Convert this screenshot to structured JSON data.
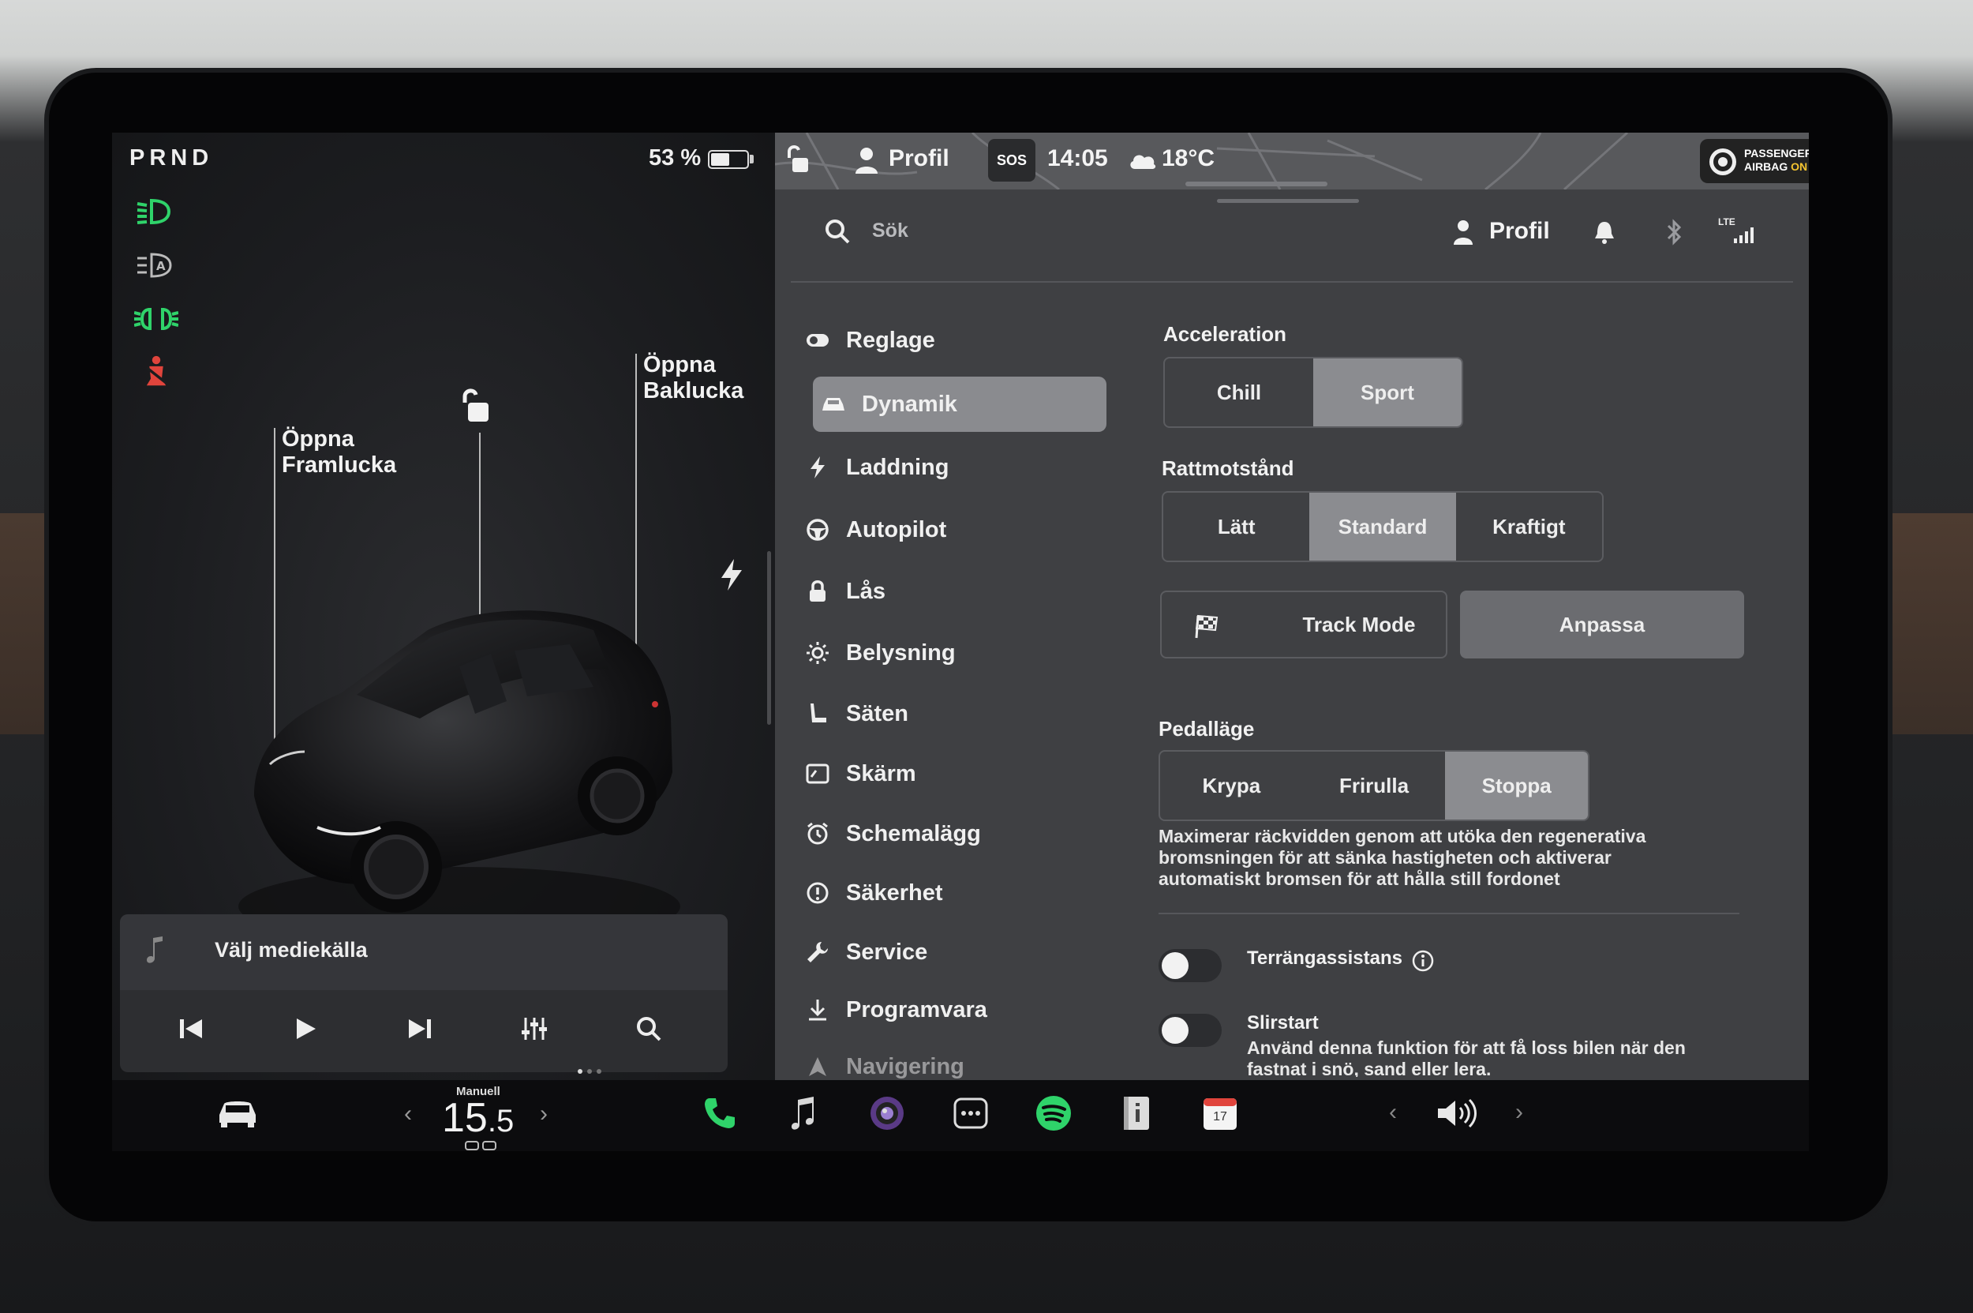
{
  "status": {
    "gear": "PRND",
    "battery_percent": "53 %",
    "battery_level": 0.53
  },
  "callouts": {
    "frunk_line1": "Öppna",
    "frunk_line2": "Framlucka",
    "trunk_line1": "Öppna",
    "trunk_line2": "Baklucka"
  },
  "media": {
    "source_label": "Välj mediekälla"
  },
  "topbar": {
    "profile": "Profil",
    "sos": "SOS",
    "time": "14:05",
    "temperature": "18°C",
    "airbag_line1": "PASSENGER",
    "airbag_line2": "AIRBAG",
    "airbag_state": "ON"
  },
  "header": {
    "search_placeholder": "Sök",
    "profile": "Profil",
    "lte": "LTE"
  },
  "sidebar": {
    "items": [
      {
        "label": "Reglage",
        "icon": "toggle-icon"
      },
      {
        "label": "Dynamik",
        "icon": "car-icon"
      },
      {
        "label": "Laddning",
        "icon": "bolt-icon"
      },
      {
        "label": "Autopilot",
        "icon": "steering-wheel-icon"
      },
      {
        "label": "Lås",
        "icon": "lock-icon"
      },
      {
        "label": "Belysning",
        "icon": "sun-icon"
      },
      {
        "label": "Säten",
        "icon": "seat-icon"
      },
      {
        "label": "Skärm",
        "icon": "display-icon"
      },
      {
        "label": "Schemalägg",
        "icon": "alarm-icon"
      },
      {
        "label": "Säkerhet",
        "icon": "alert-icon"
      },
      {
        "label": "Service",
        "icon": "wrench-icon"
      },
      {
        "label": "Programvara",
        "icon": "download-icon"
      },
      {
        "label": "Navigering",
        "icon": "navigation-icon"
      }
    ],
    "active": "Dynamik"
  },
  "settings": {
    "acceleration": {
      "title": "Acceleration",
      "options": [
        "Chill",
        "Sport"
      ],
      "selected": "Sport"
    },
    "steering": {
      "title": "Rattmotstånd",
      "options": [
        "Lätt",
        "Standard",
        "Kraftigt"
      ],
      "selected": "Standard"
    },
    "track_mode": "Track Mode",
    "customize": "Anpassa",
    "pedal": {
      "title": "Pedalläge",
      "options": [
        "Krypa",
        "Frirulla",
        "Stoppa"
      ],
      "selected": "Stoppa",
      "description": "Maximerar räckvidden genom att utöka den regenerativa bromsningen för att sänka hastigheten och aktiverar automatiskt bromsen för att hålla still fordonet"
    },
    "terrain_assist": {
      "label": "Terrängassistans",
      "enabled": false
    },
    "slip_start": {
      "label": "Slirstart",
      "enabled": false,
      "description": "Använd denna funktion för att få loss bilen när den fastnat i snö, sand eller lera."
    }
  },
  "dock": {
    "climate_mode": "Manuell",
    "temperature_int": "15",
    "temperature_dec": ".5",
    "calendar_day": "17"
  },
  "colors": {
    "accent_green": "#2fd36a",
    "warning_red": "#e0443c",
    "active_segment": "#8b8c90"
  }
}
